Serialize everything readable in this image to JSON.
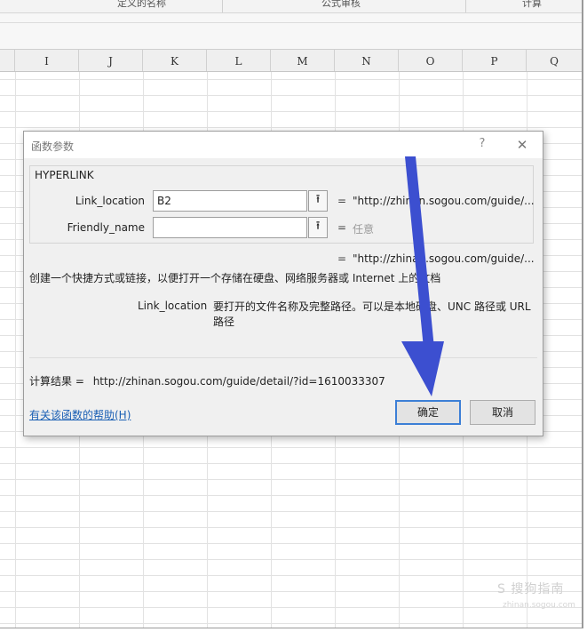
{
  "ribbon": {
    "groups": [
      "定义的名称",
      "公式审核",
      "计算"
    ]
  },
  "columns": [
    "I",
    "J",
    "K",
    "L",
    "M",
    "N",
    "O",
    "P",
    "Q"
  ],
  "dialog": {
    "title": "函数参数",
    "help_glyph": "?",
    "close_glyph": "✕",
    "function_name": "HYPERLINK",
    "args": [
      {
        "label": "Link_location",
        "value": "B2",
        "result": "\"http://zhinan.sogou.com/guide/..."
      },
      {
        "label": "Friendly_name",
        "value": "",
        "result": "任意"
      }
    ],
    "equals": "=",
    "formula_result": "\"http://zhinan.sogou.com/guide/...",
    "description": "创建一个快捷方式或链接，以便打开一个存储在硬盘、网络服务器或 Internet 上的文档",
    "arg_help": {
      "name": "Link_location",
      "text": "要打开的文件名称及完整路径。可以是本地硬盘、UNC 路径或 URL 路径"
    },
    "calc_result_label": "计算结果 =",
    "calc_result_value": "http://zhinan.sogou.com/guide/detail/?id=1610033307",
    "help_link": "有关该函数的帮助(H)",
    "ok_label": "确定",
    "cancel_label": "取消",
    "ref_icon": "⭱"
  },
  "watermark": {
    "text": "S 搜狗指南",
    "url": "zhinan.sogou.com"
  },
  "colors": {
    "annotation_arrow": "#3c4fd0",
    "link": "#1a5fb4",
    "default_button_border": "#3c7fd6"
  }
}
